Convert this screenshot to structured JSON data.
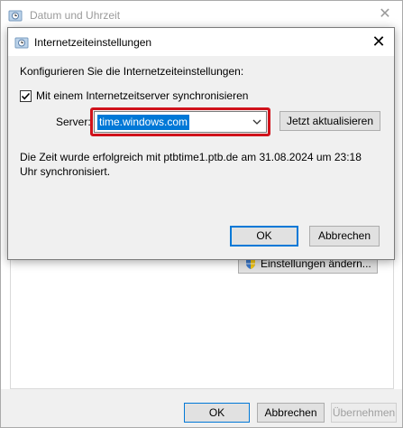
{
  "parent": {
    "title": "Datum und Uhrzeit",
    "close_symbol": "✕",
    "settings_button": "Einstellungen ändern...",
    "footer": {
      "ok": "OK",
      "cancel": "Abbrechen",
      "apply": "Übernehmen"
    }
  },
  "dialog": {
    "title": "Internetzeiteinstellungen",
    "close_symbol": "✕",
    "intro": "Konfigurieren Sie die Internetzeiteinstellungen:",
    "sync_checkbox": {
      "label": "Mit einem Internetzeitserver synchronisieren",
      "checked": true
    },
    "server_label": "Server:",
    "server_value": "time.windows.com",
    "update_button": "Jetzt aktualisieren",
    "status": "Die Zeit wurde erfolgreich mit ptbtime1.ptb.de am 31.08.2024 um 23:18 Uhr synchronisiert.",
    "ok": "OK",
    "cancel": "Abbrechen"
  },
  "colors": {
    "accent": "#0078d7",
    "highlight_border": "#d0121b",
    "button_face": "#e1e1e1",
    "dialog_bg": "#f0f0f0"
  },
  "icons": [
    "clock-globe-icon",
    "close-icon",
    "shield-icon",
    "checkmark-icon",
    "chevron-down-icon"
  ]
}
